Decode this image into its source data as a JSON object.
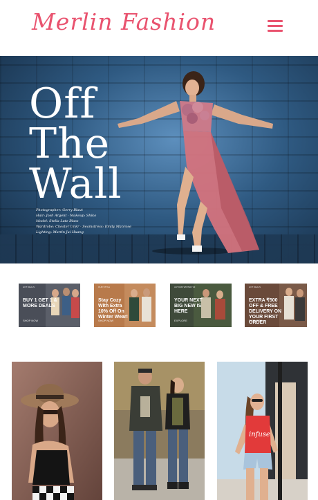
{
  "header": {
    "logo": "Merlin Fashion"
  },
  "hero": {
    "title_lines": [
      "Off",
      "The",
      "Wall"
    ],
    "credits": [
      "Photographer: Gerry Blaut",
      "Hair: Josh Argent · Makeup: Shiko",
      "Model: Stella Lutz Blass",
      "Wardrobe: Chester Unkr · Seamstress: Emily Manrose",
      "Lighting: Martin Jui Huang"
    ]
  },
  "promos": [
    {
      "tag": "HOT DEALS",
      "headline": "BUY 1 GET 1 & MORE DEALS",
      "cta": "SHOP NOW",
      "bg": "#4a4e58"
    },
    {
      "tag": "OUR STYLE",
      "headline": "Stay Cozy With Extra 10% Off On Winter Wear!",
      "cta": "SHOP NOW",
      "bg": "#b87a4b"
    },
    {
      "tag": "AUTUMN WINTER '23",
      "headline": "YOUR NEXT BIG NEW IS HERE",
      "cta": "EXPLORE",
      "bg": "#3f4a3a"
    },
    {
      "tag": "HOT DEALS",
      "headline": "EXTRA ₹500 OFF & FREE DELIVERY ON YOUR FIRST ORDER",
      "cta": "EXPLORE",
      "bg": "#6a4a3a"
    }
  ],
  "tiles": [
    {
      "alt": "Woman in sun hat and sunglasses",
      "bg": "#8a6458"
    },
    {
      "alt": "Couple in jackets and jeans",
      "bg": "#7a6d5a"
    },
    {
      "alt": "Woman in red top and denim shorts",
      "bg": "#c7dbe8"
    }
  ],
  "colors": {
    "brand": "#e9536f"
  }
}
